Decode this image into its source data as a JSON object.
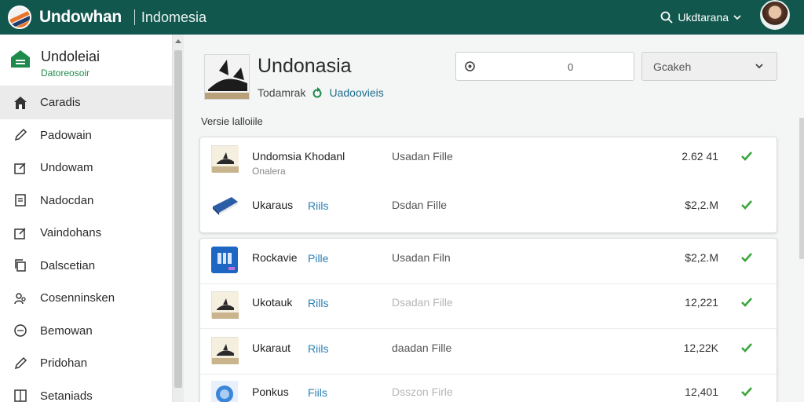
{
  "header": {
    "brand": "Undowhan",
    "region": "Indomesia",
    "user_name": "Ukdtarana"
  },
  "sidebar": {
    "title": "Undoleiai",
    "subtitle": "Datoreosoir",
    "items": [
      {
        "label": "Caradis",
        "icon": "home-icon"
      },
      {
        "label": "Padowain",
        "icon": "pen-icon"
      },
      {
        "label": "Undowam",
        "icon": "edit-box-icon"
      },
      {
        "label": "Nadocdan",
        "icon": "document-icon"
      },
      {
        "label": "Vaindohans",
        "icon": "edit-box-icon"
      },
      {
        "label": "Dalscetian",
        "icon": "copy-icon"
      },
      {
        "label": "Cosenninsken",
        "icon": "users-icon"
      },
      {
        "label": "Bemowan",
        "icon": "globe-icon"
      },
      {
        "label": "Pridohan",
        "icon": "pen-icon"
      },
      {
        "label": "Setaniads",
        "icon": "grid-icon"
      }
    ]
  },
  "document": {
    "title": "Undonasia",
    "meta_left": "Todamrak",
    "meta_link": "Uadoovieis"
  },
  "search": {
    "value": "0"
  },
  "filter": {
    "selected": "Gcakeh"
  },
  "section_label": "Versie lalloiile",
  "files": [
    {
      "name": "Undomsia Khodanl",
      "sub": "Onalera",
      "tag": "",
      "type": "Usadan Fille",
      "size": "2.62 41",
      "thumb": "shark"
    },
    {
      "name": "Ukaraus",
      "sub": "",
      "tag": "Riils",
      "type": "Dsdan Fille",
      "size": "$2,2.M",
      "thumb": "book"
    },
    {
      "name": "Rockavie",
      "sub": "",
      "tag": "Pille",
      "type": "Usadan Filn",
      "size": "$2,2.M",
      "thumb": "app"
    },
    {
      "name": "Ukotauk",
      "sub": "",
      "tag": "Rills",
      "type": "Dsadan Fille",
      "size": "12,221",
      "thumb": "shark"
    },
    {
      "name": "Ukaraut",
      "sub": "",
      "tag": "Riils",
      "type": "daadan Fille",
      "size": "12,22K",
      "thumb": "shark"
    },
    {
      "name": "Ponkus",
      "sub": "",
      "tag": "Fiils",
      "type": "Dsszon Firle",
      "size": "12,401",
      "thumb": "globe"
    }
  ],
  "colors": {
    "topbar": "#12574d",
    "check": "#3aa53a",
    "link": "#2a7fb5"
  }
}
